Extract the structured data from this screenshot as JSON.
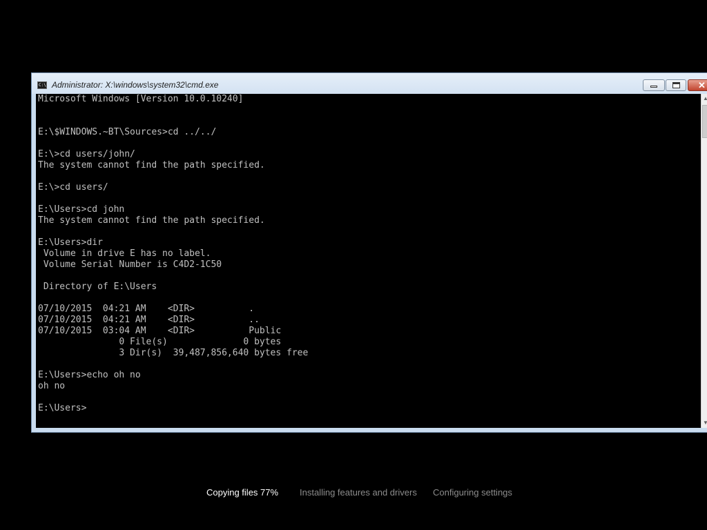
{
  "window": {
    "title": "Administrator: X:\\windows\\system32\\cmd.exe",
    "icon": "cmd-icon",
    "icon_text": "C:\\",
    "minimize_icon": "minimize-icon",
    "maximize_icon": "maximize-icon",
    "close_icon": "close-icon",
    "close_glyph": "✕"
  },
  "console": {
    "text_color": "#c0c0c0",
    "background": "#000000",
    "output": "Microsoft Windows [Version 10.0.10240]\n\n\nE:\\$WINDOWS.~BT\\Sources>cd ../../\n\nE:\\>cd users/john/\nThe system cannot find the path specified.\n\nE:\\>cd users/\n\nE:\\Users>cd john\nThe system cannot find the path specified.\n\nE:\\Users>dir\n Volume in drive E has no label.\n Volume Serial Number is C4D2-1C50\n\n Directory of E:\\Users\n\n07/10/2015  04:21 AM    <DIR>          .\n07/10/2015  04:21 AM    <DIR>          ..\n07/10/2015  03:04 AM    <DIR>          Public\n               0 File(s)              0 bytes\n               3 Dir(s)  39,487,856,640 bytes free\n\nE:\\Users>echo oh no\noh no\n\nE:\\Users>"
  },
  "scrollbar": {
    "up_glyph": "▲",
    "down_glyph": "▼"
  },
  "setup_progress": {
    "steps": [
      {
        "label": "Copying files 77%",
        "state": "active"
      },
      {
        "label": "Installing features and drivers",
        "state": "inactive"
      },
      {
        "label": "Configuring settings",
        "state": "inactive"
      }
    ]
  }
}
